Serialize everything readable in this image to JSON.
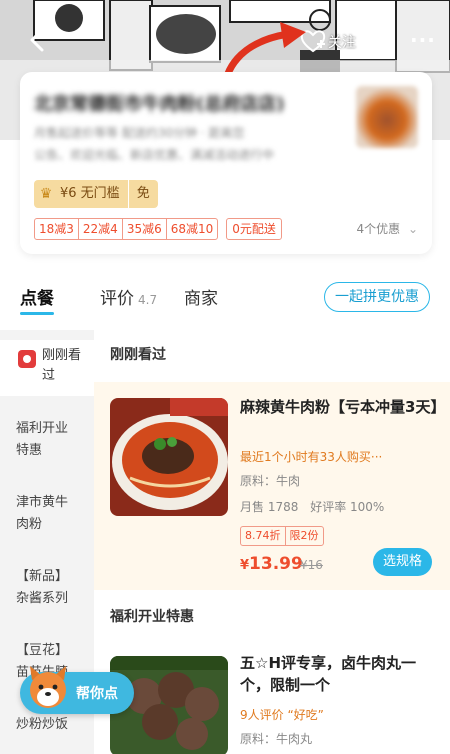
{
  "nav": {
    "back_icon": "chevron-left-icon",
    "favorite_label": "关注",
    "more_icon": "more-dots-icon"
  },
  "store": {
    "name_blurred": "北京常德街市牛肉粉(总府店店)",
    "line1_blurred": "月售起送价等等 配送约30分钟 · 距离您",
    "line2_blurred": "公告、欢迎光临、新店优惠、满减活动进行中",
    "rank_text": "¥6 无门槛",
    "rank_tag": "免",
    "coupons": [
      "18减3",
      "22减4",
      "35减6",
      "68减10"
    ],
    "delivery_free": "0元配送",
    "offers_label": "4个优惠"
  },
  "tabs": {
    "order": "点餐",
    "reviews": "评价",
    "reviews_score": "4.7",
    "merchant": "商家",
    "group_button": "一起拼更优惠"
  },
  "categories": {
    "recent": "刚刚看过",
    "items": [
      "福利开业特惠",
      "津市黄牛肉粉",
      "【新品】杂酱系列",
      "【豆花】苗苗牛腩",
      "炒粉炒饭"
    ]
  },
  "sections": {
    "recent_title": "刚刚看过",
    "welfare_title": "福利开业特惠"
  },
  "dish1": {
    "name": "麻辣黄牛肉粉【亏本冲量3天】",
    "hot": "最近1个小时有33人购买···",
    "ingredients": "原料：牛肉",
    "sales": "月售 1788",
    "rating": "好评率 100%",
    "discount": "8.74折",
    "limit": "限2份",
    "price_symbol": "¥",
    "price": "13.99",
    "original_price": "¥16",
    "spec_button": "选规格"
  },
  "dish2": {
    "name": "五☆H评专享，卤牛肉丸一个，限制一个",
    "hot": "9人评价 “好吃”",
    "ingredients": "原料：牛肉丸"
  },
  "helper": {
    "label": "帮你点"
  },
  "colors": {
    "accent": "#2bb7e8",
    "price_red": "#ee4d2d",
    "hot_orange": "#e07a1f",
    "highlight_bg": "#fff8ec"
  }
}
